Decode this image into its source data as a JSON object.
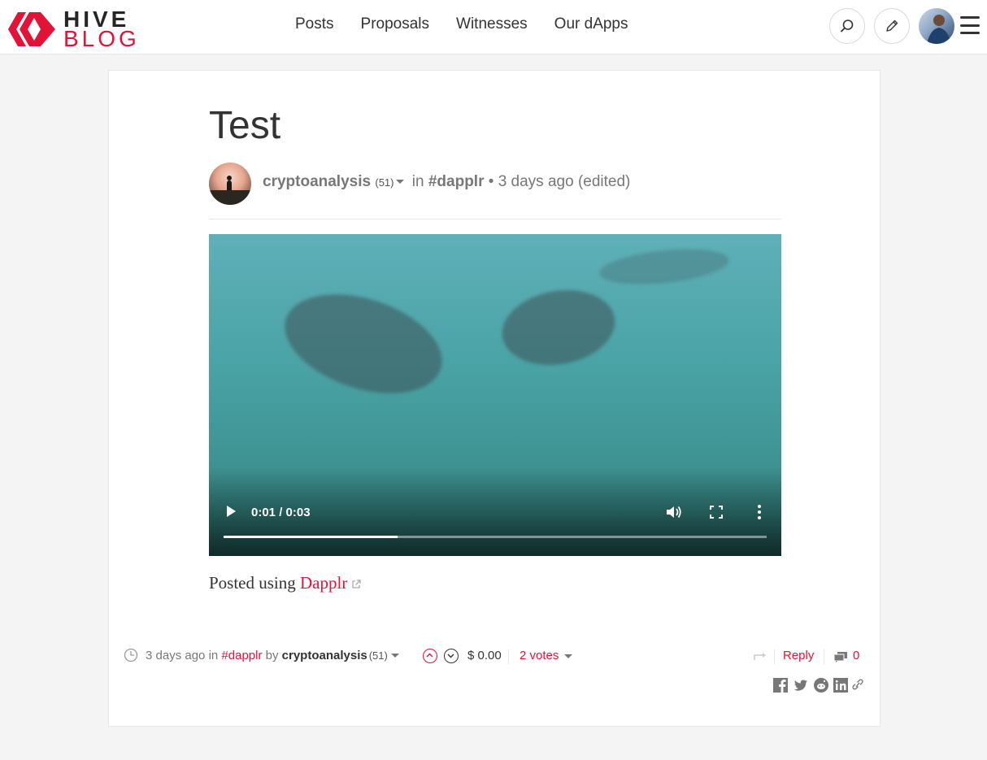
{
  "header": {
    "logo_line1": "HIVE",
    "logo_line2": "BLOG",
    "nav": [
      {
        "label": "Posts"
      },
      {
        "label": "Proposals"
      },
      {
        "label": "Witnesses"
      },
      {
        "label": "Our dApps"
      }
    ]
  },
  "post": {
    "title": "Test",
    "author": "cryptoanalysis",
    "reputation": "(51)",
    "in_word": "in",
    "tag": "#dapplr",
    "bullet": "•",
    "time": "3 days ago",
    "edited": "(edited)",
    "video": {
      "time_display": "0:01 / 0:03",
      "progress": 0.32
    },
    "body_prefix": "Posted using",
    "body_link": "Dapplr"
  },
  "footer": {
    "time": "3 days ago",
    "in_word": "in",
    "tag": "#dapplr",
    "by_word": "by",
    "author": "cryptoanalysis",
    "reputation": "(51)",
    "payout": "$ 0.00",
    "votes": "2 votes",
    "reply": "Reply",
    "comments": "0"
  },
  "colors": {
    "brand_red": "#e31337",
    "text_dark": "#333333",
    "text_muted": "#777777"
  }
}
